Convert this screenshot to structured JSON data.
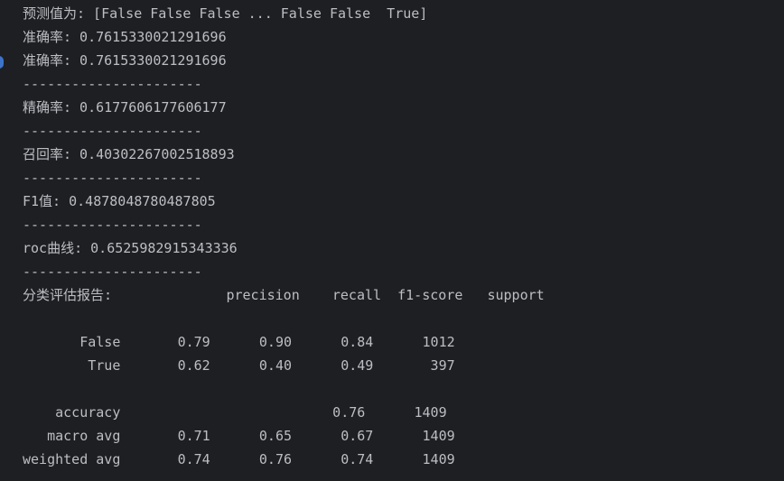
{
  "console": {
    "lines": [
      "预测值为: [False False False ... False False  True]",
      "准确率: 0.7615330021291696",
      "准确率: 0.7615330021291696",
      "----------------------",
      "精确率: 0.6177606177606177",
      "----------------------",
      "召回率: 0.40302267002518893",
      "----------------------",
      "F1值: 0.4878048780487805",
      "----------------------",
      "roc曲线: 0.6525982915343336",
      "----------------------",
      "分类评估报告:              precision    recall  f1-score   support",
      "",
      "       False       0.79      0.90      0.84      1012",
      "        True       0.62      0.40      0.49       397",
      "",
      "    accuracy                          0.76      1409",
      "   macro avg       0.71      0.65      0.67      1409",
      "weighted avg       0.74      0.76      0.74      1409"
    ]
  }
}
